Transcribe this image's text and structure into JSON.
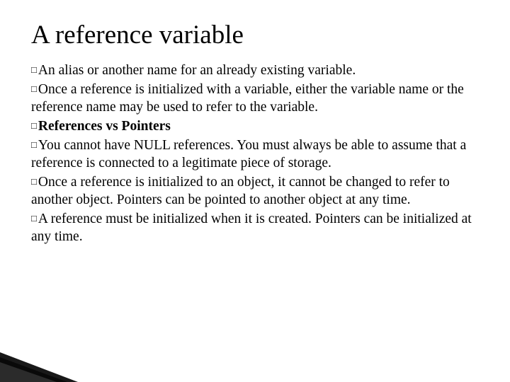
{
  "title": "A reference variable",
  "bullets": [
    {
      "lead": "An",
      "rest": " alias or another name for an already existing variable."
    },
    {
      "lead": "Once",
      "rest": " a reference is initialized with a variable, either the variable name or the reference name may be used to refer to the variable."
    },
    {
      "lead": "References",
      "rest": " vs Pointers",
      "bold_rest": true
    },
    {
      "lead": "You",
      "rest": " cannot have NULL references. You must always be able to assume that a reference is connected to a legitimate piece of storage."
    },
    {
      "lead": "Once",
      "rest": " a reference is initialized to an object, it cannot be changed to refer to another object. Pointers can be pointed to another object at any time."
    },
    {
      "lead": "A",
      "rest": " reference must be initialized when it is created. Pointers can be initialized at any time."
    }
  ],
  "square_glyph": "□"
}
